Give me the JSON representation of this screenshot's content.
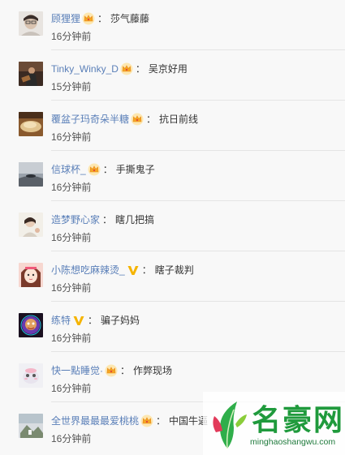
{
  "comments": [
    {
      "username": "顾狸狸",
      "badge": "crown-icon",
      "text": "莎气藤藤",
      "time": "16分钟前"
    },
    {
      "username": "Tinky_Winky_D",
      "badge": "crown-icon",
      "text": "吴京好用",
      "time": "15分钟前"
    },
    {
      "username": "覆盆子玛奇朵半糖",
      "badge": "crown-icon",
      "text": "抗日前线",
      "time": "16分钟前"
    },
    {
      "username": "信球杯_",
      "badge": "crown-icon",
      "text": "手撕鬼子",
      "time": "16分钟前"
    },
    {
      "username": "造梦野心家",
      "badge": "",
      "text": "瞎几把搞",
      "time": "16分钟前"
    },
    {
      "username": "小陈想吃麻辣烫_",
      "badge": "verified-v-icon",
      "text": "瞎子裁判",
      "time": "16分钟前"
    },
    {
      "username": "练特",
      "badge": "verified-v-icon",
      "text": "骗子妈妈",
      "time": "16分钟前"
    },
    {
      "username": "快一點睡觉·",
      "badge": "crown-icon",
      "text": "作弊现场",
      "time": "16分钟前"
    },
    {
      "username": "全世界最最最爱桃桃",
      "badge": "crown-icon",
      "text": "中国牛逼",
      "time": "16分钟前"
    }
  ],
  "watermark": {
    "name": "名豪网",
    "url": "minghaoshangwu.com"
  },
  "colors": {
    "username": "#5a7fb8",
    "crown": "#f5a623",
    "verified": "#f5b400",
    "watermark": "#1f9a3c"
  }
}
